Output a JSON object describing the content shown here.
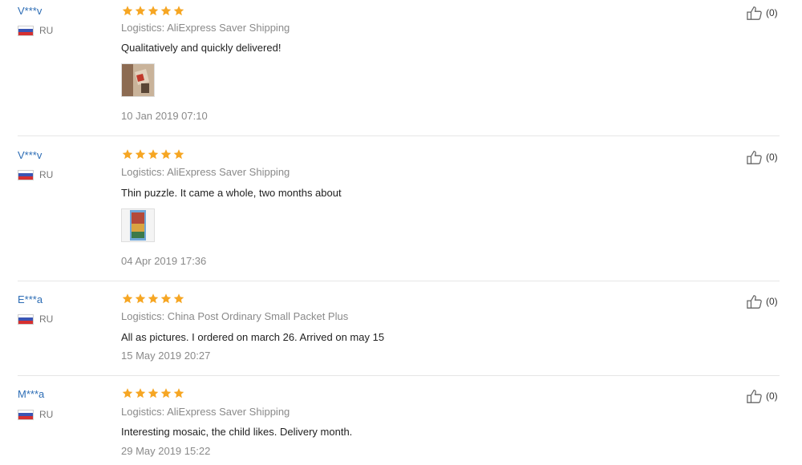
{
  "reviews": [
    {
      "user": "V***v",
      "country": "RU",
      "stars_icon": "five-star-rating",
      "logistics": "Logistics: AliExpress Saver Shipping",
      "text": "Qualitatively and quickly delivered!",
      "has_photo": true,
      "date": "10 Jan 2019 07:10",
      "likes": "(0)"
    },
    {
      "user": "V***v",
      "country": "RU",
      "stars_icon": "five-star-rating",
      "logistics": "Logistics: AliExpress Saver Shipping",
      "text": "Thin puzzle. It came a whole, two months about",
      "has_photo": true,
      "date": "04 Apr 2019 17:36",
      "likes": "(0)"
    },
    {
      "user": "E***a",
      "country": "RU",
      "stars_icon": "five-star-rating",
      "logistics": "Logistics: China Post Ordinary Small Packet Plus",
      "text": "All as pictures. I ordered on march 26. Arrived on may 15",
      "has_photo": false,
      "date": "15 May 2019 20:27",
      "likes": "(0)"
    },
    {
      "user": "M***a",
      "country": "RU",
      "stars_icon": "five-star-rating",
      "logistics": "Logistics: AliExpress Saver Shipping",
      "text": "Interesting mosaic, the child likes. Delivery month.",
      "has_photo": false,
      "date": "29 May 2019 15:22",
      "likes": "(0)"
    }
  ],
  "colors": {
    "username": "#2d6db5",
    "star": "#f6a623",
    "muted": "#8a8a8a",
    "divider": "#e6e6e6"
  }
}
